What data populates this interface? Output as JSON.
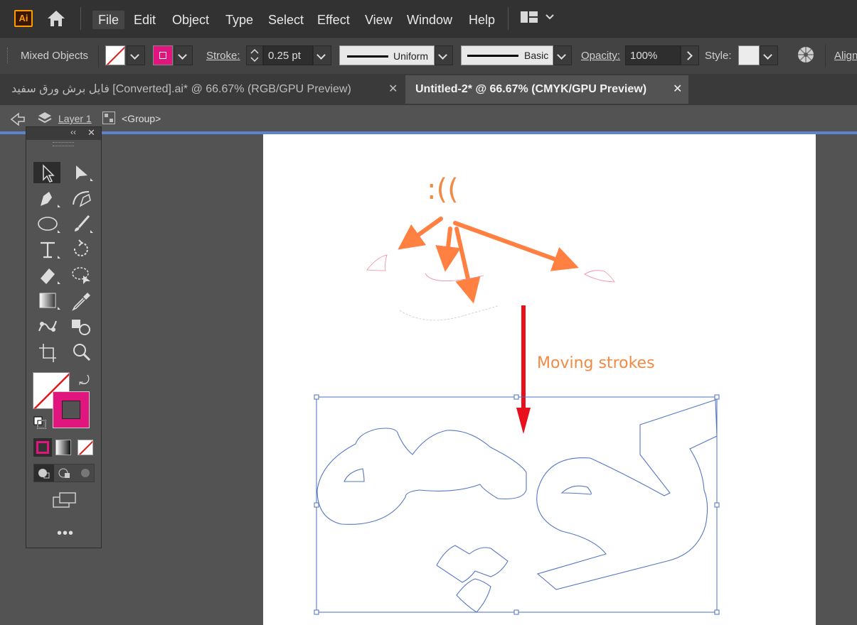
{
  "app": {
    "logo_text": "Ai"
  },
  "menu": [
    "File",
    "Edit",
    "Object",
    "Type",
    "Select",
    "Effect",
    "View",
    "Window",
    "Help"
  ],
  "control_bar": {
    "selection_label": "Mixed Objects",
    "stroke_label": "Stroke:",
    "stroke_weight": "0.25 pt",
    "profile": "Uniform",
    "brush": "Basic",
    "opacity_label": "Opacity:",
    "opacity_value": "100%",
    "style_label": "Style:",
    "align_label": "Align"
  },
  "tabs": [
    {
      "title": "فایل برش ورق سفید [Converted].ai* @ 66.67% (RGB/GPU Preview)",
      "active": false
    },
    {
      "title": "Untitled-2* @ 66.67% (CMYK/GPU Preview)",
      "active": true
    }
  ],
  "breadcrumb": {
    "layer": "Layer 1",
    "group": "<Group>"
  },
  "artboard": {
    "sad_face": ":((",
    "annotation": "Moving strokes",
    "annotation_color": "#f08a45",
    "arrow_color": "#ff8040",
    "red_arrow_color": "#e8101a",
    "selection_color": "#4a6fc0"
  },
  "colors": {
    "fill": "none",
    "stroke": "#e0157e"
  },
  "icons": [
    "home-icon",
    "workspace-icon",
    "selection-tool-icon",
    "direct-selection-tool-icon",
    "pen-tool-icon",
    "curvature-tool-icon",
    "ellipse-tool-icon",
    "paintbrush-tool-icon",
    "type-tool-icon",
    "rotate-tool-icon",
    "eraser-tool-icon",
    "lasso-tool-icon",
    "gradient-tool-icon",
    "eyedropper-tool-icon",
    "puppet-warp-tool-icon",
    "shape-builder-tool-icon",
    "artboard-tool-icon",
    "zoom-tool-icon"
  ]
}
